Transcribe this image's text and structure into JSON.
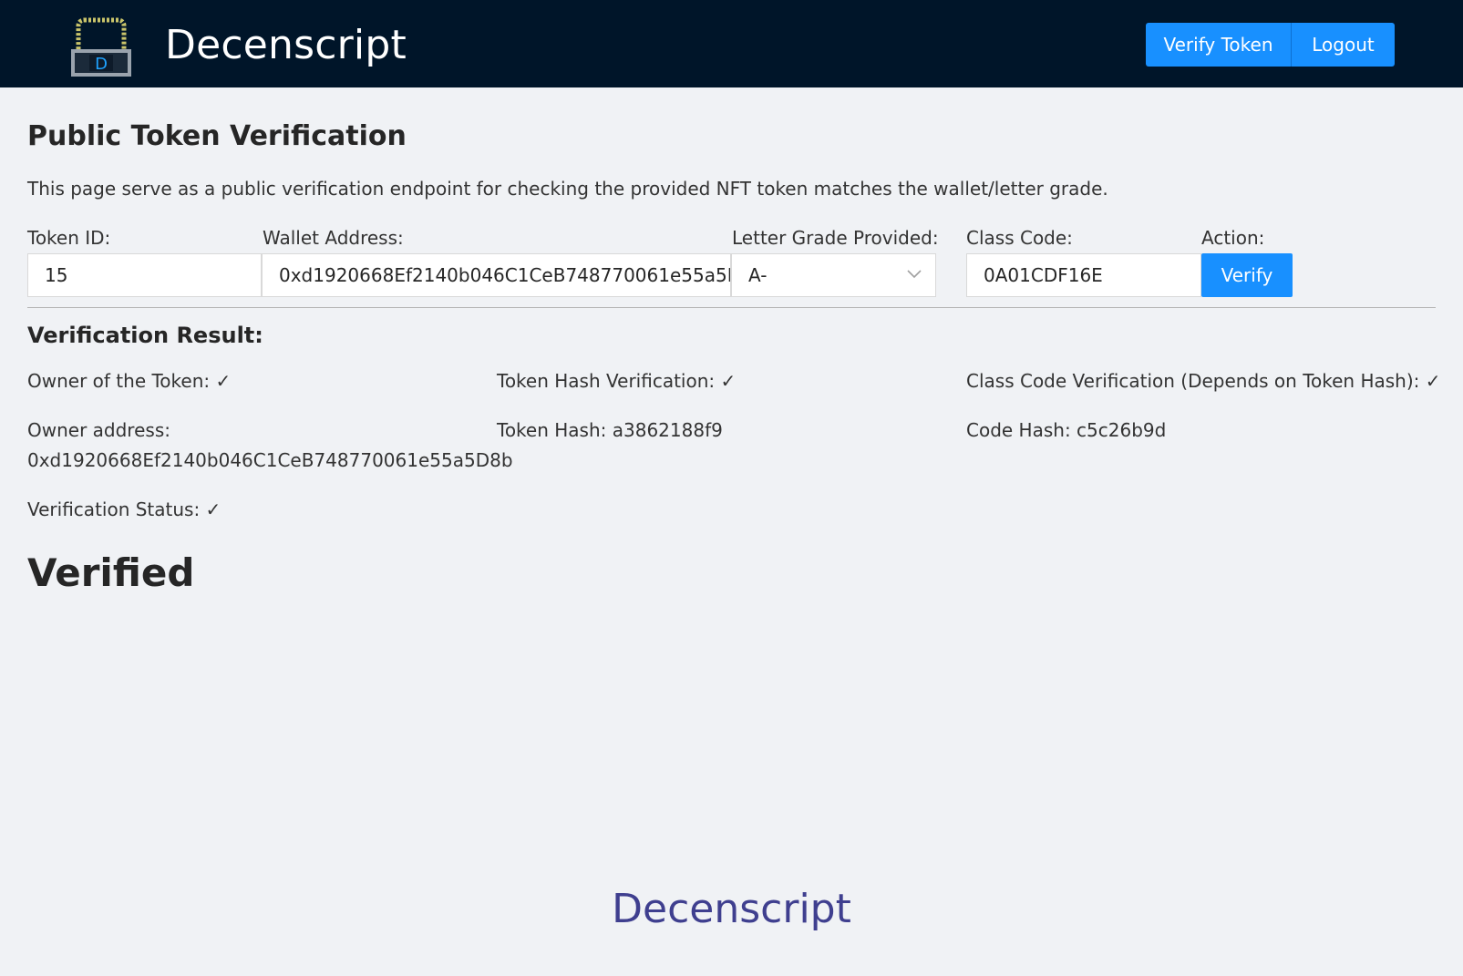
{
  "header": {
    "brand": "Decenscript",
    "logo_letter": "D",
    "nav": [
      "Verify Token",
      "Logout"
    ]
  },
  "page": {
    "title": "Public Token Verification",
    "description": "This page serve as a public verification endpoint for checking the provided NFT token matches the wallet/letter grade."
  },
  "form": {
    "token_id_label": "Token ID:",
    "token_id_value": "15",
    "wallet_label": "Wallet Address:",
    "wallet_value": "0xd1920668Ef2140b046C1CeB748770061e55a5D8b",
    "grade_label": "Letter Grade Provided:",
    "grade_value": "A-",
    "class_code_label": "Class Code:",
    "class_code_value": "0A01CDF16E",
    "action_label": "Action:",
    "verify_button": "Verify"
  },
  "result": {
    "title": "Verification Result:",
    "owner_of_token": "Owner of the Token: ✓",
    "token_hash_verification": "Token Hash Verification: ✓",
    "class_code_verification": "Class Code Verification (Depends on Token Hash): ✓",
    "owner_address_label": "Owner address:",
    "owner_address_value": "0xd1920668Ef2140b046C1CeB748770061e55a5D8b",
    "token_hash": "Token Hash: a3862188f9",
    "code_hash": "Code Hash: c5c26b9d",
    "verification_status": "Verification Status: ✓",
    "status_text": "Verified"
  },
  "footer": {
    "brand": "Decenscript"
  },
  "colors": {
    "header_bg": "#001529",
    "primary": "#1890ff",
    "page_bg": "#f0f2f5",
    "footer_text": "#3f3f8f"
  }
}
